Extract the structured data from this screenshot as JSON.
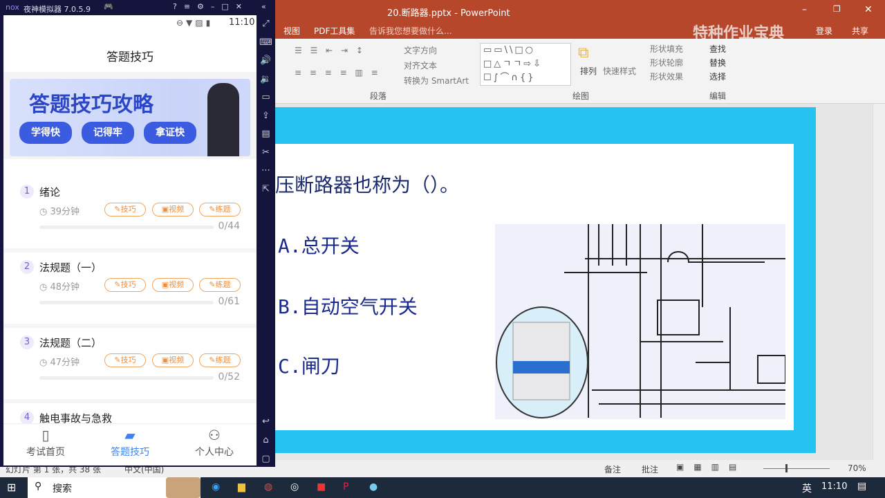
{
  "ppt": {
    "title": "20.断路器.pptx - PowerPoint",
    "menu": [
      "视图",
      "PDF工具集"
    ],
    "tell_me": "告诉我您想要做什么...",
    "watermark": "特种作业宝典",
    "login": "登录",
    "share": "共享",
    "ribbon": {
      "text_direction": "文字方向",
      "align_text": "对齐文本",
      "smartart": "转换为 SmartArt",
      "arrange": "排列",
      "quick_styles": "快速样式",
      "shape_fill": "形状填充",
      "shape_outline": "形状轮廓",
      "shape_effects": "形状效果",
      "find": "查找",
      "replace": "替换",
      "select": "选择",
      "groups": [
        "段落",
        "绘图",
        "编辑"
      ]
    },
    "slide": {
      "question": "压断路器也称为（）。",
      "options": [
        "A.总开关",
        "B.自动空气开关",
        "C.闸刀"
      ]
    },
    "status": {
      "slide_info": "幻灯片 第 1 张，共 38 张",
      "language": "中文(中国)",
      "notes": "备注",
      "comments": "批注",
      "zoom": "70%"
    }
  },
  "nox": {
    "title": "夜神模拟器 7.0.5.9",
    "logo": "nox"
  },
  "phone": {
    "time": "11:10",
    "header": "答题技巧",
    "banner": {
      "title": "答题技巧攻略",
      "tags": [
        "学得快",
        "记得牢",
        "拿证快"
      ]
    },
    "chapters": [
      {
        "num": "1",
        "name": "绪论",
        "duration": "39分钟",
        "progress": "0/44"
      },
      {
        "num": "2",
        "name": "法规题（一）",
        "duration": "48分钟",
        "progress": "0/61"
      },
      {
        "num": "3",
        "name": "法规题（二）",
        "duration": "47分钟",
        "progress": "0/52"
      },
      {
        "num": "4",
        "name": "触电事故与急救"
      }
    ],
    "pills": [
      "技巧",
      "视频",
      "练题"
    ],
    "nav": [
      {
        "label": "考试首页"
      },
      {
        "label": "答题技巧"
      },
      {
        "label": "个人中心"
      }
    ],
    "active_color": "#3b82f6"
  },
  "taskbar": {
    "search": "搜索",
    "ime": "英",
    "time": "11:10"
  }
}
